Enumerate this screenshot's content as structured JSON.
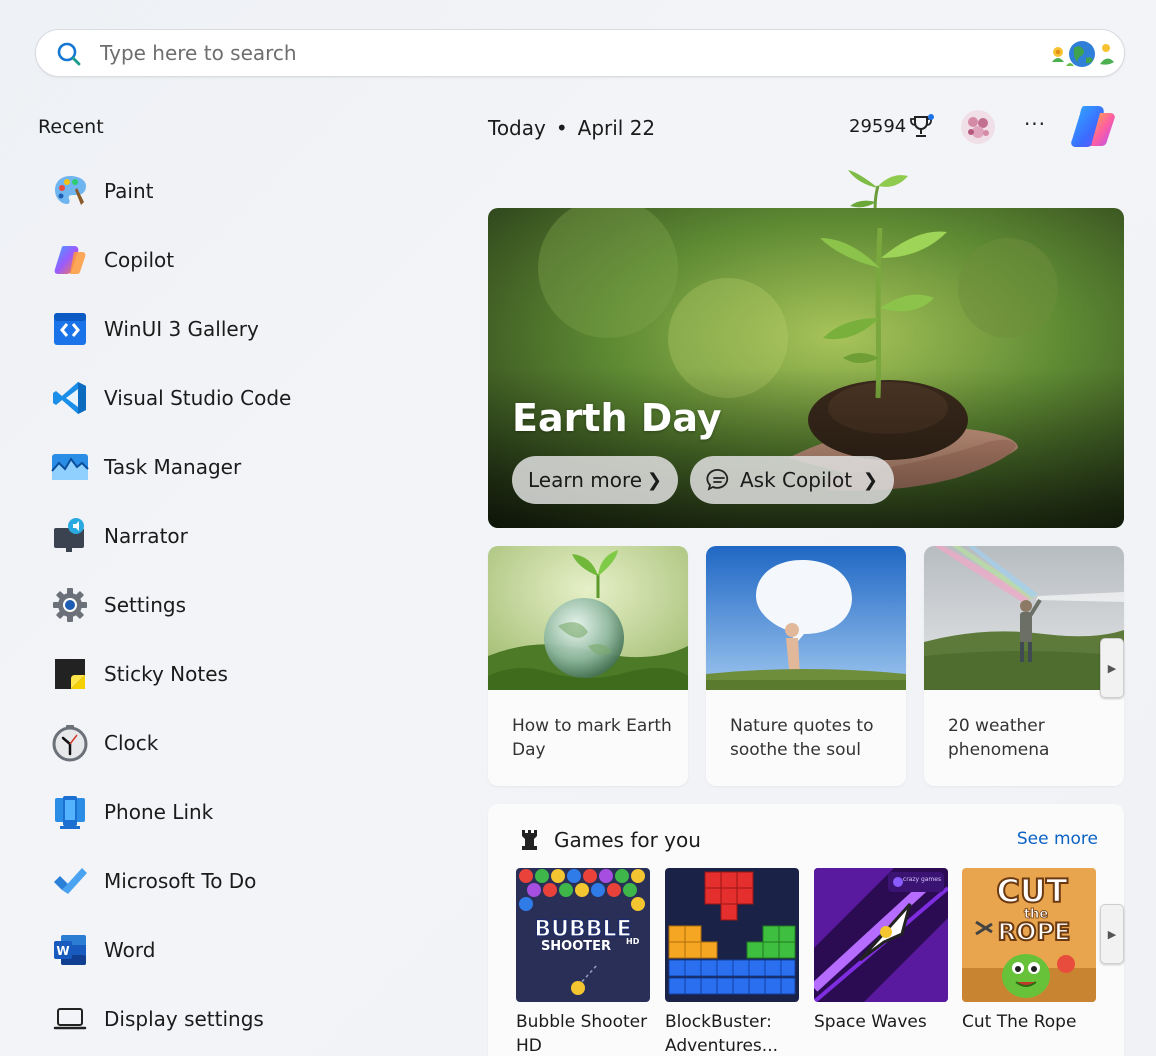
{
  "search": {
    "placeholder": "Type here to search",
    "icon": "search-icon",
    "accent": "#1676d2"
  },
  "recent": {
    "title": "Recent",
    "items": [
      {
        "label": "Paint",
        "icon": "paint-icon"
      },
      {
        "label": "Copilot",
        "icon": "copilot-icon"
      },
      {
        "label": "WinUI 3 Gallery",
        "icon": "winui-gallery-icon"
      },
      {
        "label": "Visual Studio Code",
        "icon": "vscode-icon"
      },
      {
        "label": "Task Manager",
        "icon": "task-manager-icon"
      },
      {
        "label": "Narrator",
        "icon": "narrator-icon"
      },
      {
        "label": "Settings",
        "icon": "settings-icon"
      },
      {
        "label": "Sticky Notes",
        "icon": "sticky-notes-icon"
      },
      {
        "label": "Clock",
        "icon": "clock-icon"
      },
      {
        "label": "Phone Link",
        "icon": "phone-link-icon"
      },
      {
        "label": "Microsoft To Do",
        "icon": "todo-icon"
      },
      {
        "label": "Word",
        "icon": "word-icon"
      },
      {
        "label": "Display settings",
        "icon": "laptop-icon"
      }
    ]
  },
  "header": {
    "today_label": "Today",
    "separator": "•",
    "date": "April 22",
    "points": "29594",
    "more": "···"
  },
  "hero": {
    "title": "Earth Day",
    "learn_more": "Learn more",
    "ask_copilot": "Ask Copilot"
  },
  "cards": [
    {
      "caption": "How to mark Earth Day"
    },
    {
      "caption": "Nature quotes to soothe the soul"
    },
    {
      "caption": "20 weather phenomena"
    }
  ],
  "games": {
    "title": "Games for you",
    "see_more": "See more",
    "items": [
      {
        "name": "Bubble Shooter HD",
        "art_line1": "BUBBLE",
        "art_line2": "SHOOTER",
        "art_badge": "HD"
      },
      {
        "name": "BlockBuster: Adventures..."
      },
      {
        "name": "Space Waves",
        "art_badge": "crazy games"
      },
      {
        "name": "Cut The Rope",
        "art_line1": "CUT",
        "art_line2": "the",
        "art_line3": "ROPE"
      }
    ]
  },
  "colors": {
    "link": "#0a62c4",
    "text": "#1b1b1b"
  }
}
